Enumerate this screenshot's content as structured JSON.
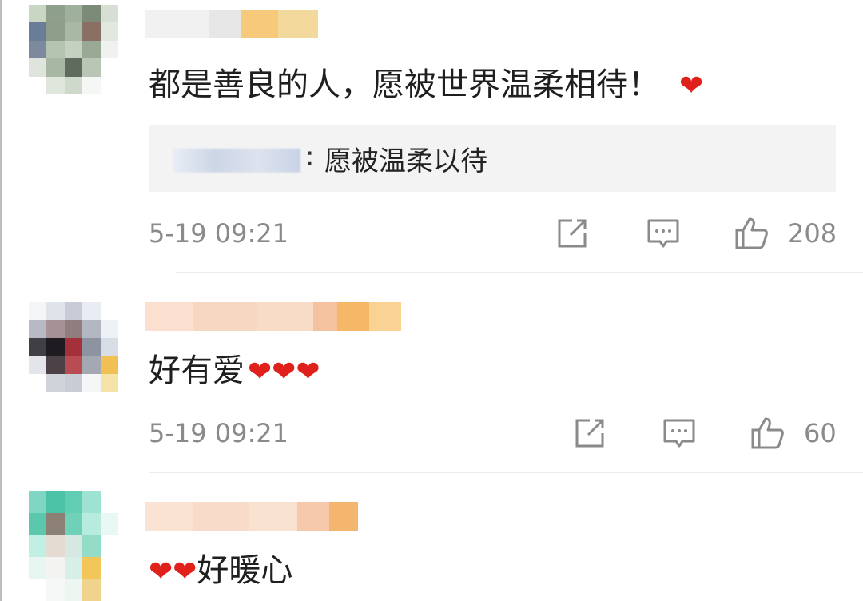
{
  "comments": [
    {
      "text": "都是善良的人，愿被世界温柔相待！",
      "emoji": "❤",
      "reply": {
        "separator": ":",
        "text": "愿被温柔以待"
      },
      "timestamp": "5-19 09:21",
      "likes": "208"
    },
    {
      "text": "好有爱",
      "emoji": "❤❤❤",
      "timestamp": "5-19 09:21",
      "likes": "60"
    },
    {
      "text_prefix": "❤❤",
      "text": "好暖心"
    }
  ],
  "icons": {
    "forward": "share-box-icon",
    "comment": "comment-bubble-icon",
    "like": "thumbs-up-icon"
  },
  "colors": {
    "heart": "#e0201b",
    "meta_text": "#8a8a8a",
    "reply_bg": "#f3f3f3"
  }
}
